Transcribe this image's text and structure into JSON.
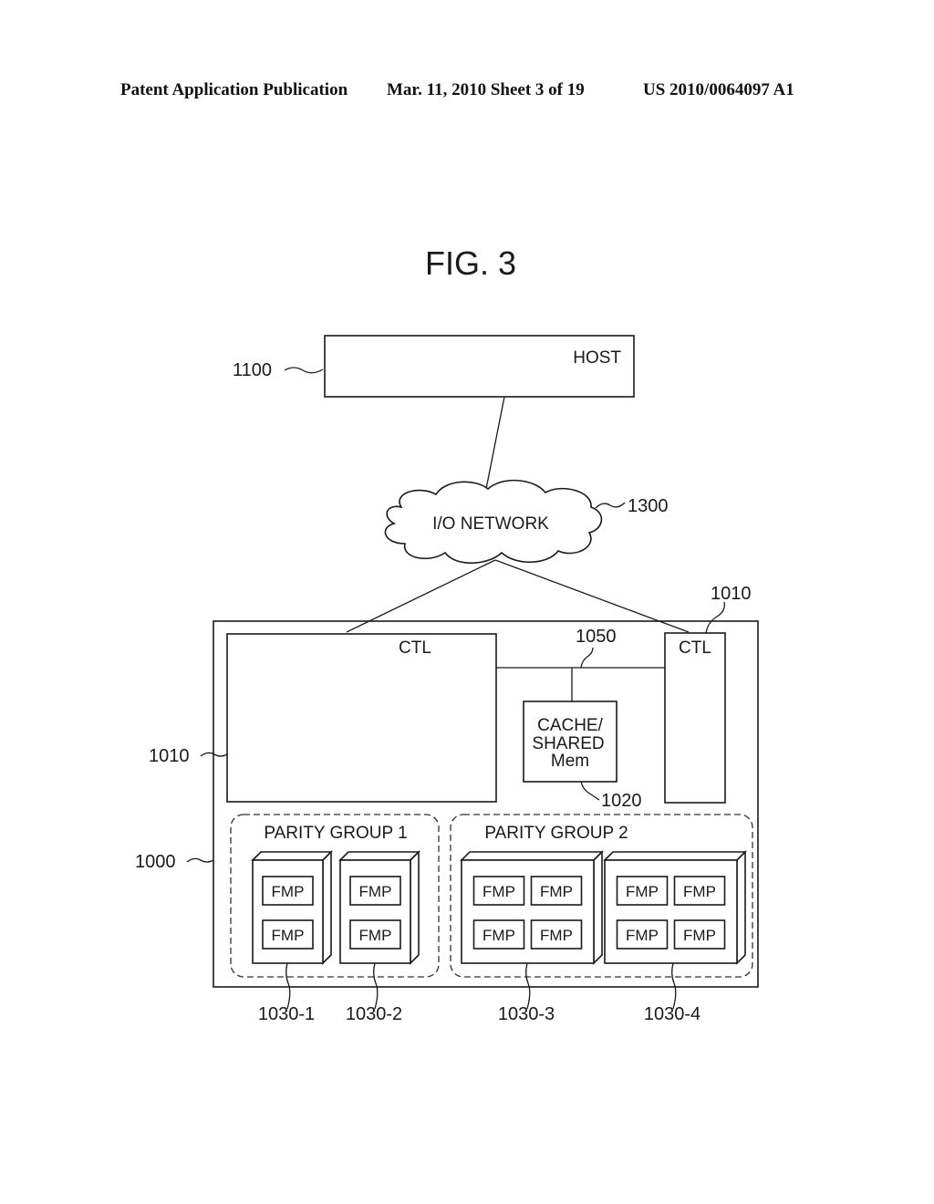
{
  "header": {
    "publication": "Patent Application Publication",
    "date_sheet": "Mar. 11, 2010  Sheet 3 of 19",
    "number": "US 2010/0064097 A1"
  },
  "figure": {
    "title": "FIG. 3",
    "host": {
      "label": "HOST",
      "ref": "1100"
    },
    "network": {
      "label": "I/O NETWORK",
      "ref": "1300"
    },
    "storage": {
      "ref": "1000"
    },
    "controllers": [
      {
        "label": "CTL",
        "ref": "1010"
      },
      {
        "label": "CTL",
        "ref": "1010"
      }
    ],
    "bus": {
      "ref": "1050"
    },
    "cache": {
      "lines": [
        "CACHE/",
        "SHARED",
        "Mem"
      ],
      "ref": "1020"
    },
    "parity_groups": [
      {
        "label": "PARITY GROUP 1"
      },
      {
        "label": "PARITY GROUP 2"
      }
    ],
    "fmp_label": "FMP",
    "drives": [
      {
        "ref": "1030-1"
      },
      {
        "ref": "1030-2"
      },
      {
        "ref": "1030-3"
      },
      {
        "ref": "1030-4"
      }
    ]
  }
}
